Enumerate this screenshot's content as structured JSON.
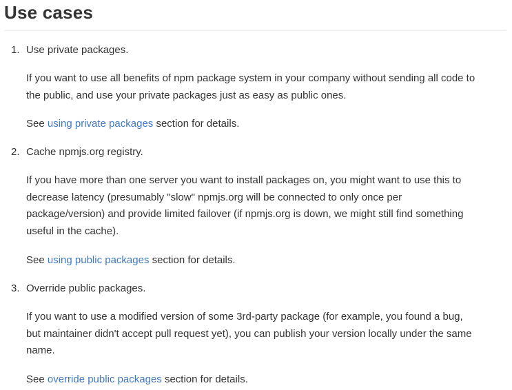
{
  "heading": "Use cases",
  "items": [
    {
      "number": "1.",
      "title": "Use private packages.",
      "description_lines": [
        "If you want to use all benefits of npm package system in your company without sending all code to",
        "the public, and use your private packages just as easy as public ones."
      ],
      "see_prefix": "See ",
      "link_text": "using private packages",
      "see_suffix": " section for details."
    },
    {
      "number": "2.",
      "title": "Cache npmjs.org registry.",
      "description_lines": [
        "If you have more than one server you want to install packages on, you might want to use this to",
        "decrease latency (presumably \"slow\" npmjs.org will be connected to only once per",
        "package/version) and provide limited failover (if npmjs.org is down, we might still find something",
        "useful in the cache)."
      ],
      "see_prefix": "See ",
      "link_text": "using public packages",
      "see_suffix": " section for details."
    },
    {
      "number": "3.",
      "title": "Override public packages.",
      "description_lines": [
        "If you want to use a modified version of some 3rd-party package (for example, you found a bug,",
        "but maintainer didn't accept pull request yet), you can publish your version locally under the same",
        "name."
      ],
      "see_prefix": "See ",
      "link_text": "override public packages",
      "see_suffix": " section for details."
    }
  ],
  "colors": {
    "text": "#333333",
    "link": "#4078c0",
    "rule": "#eeeeee"
  }
}
